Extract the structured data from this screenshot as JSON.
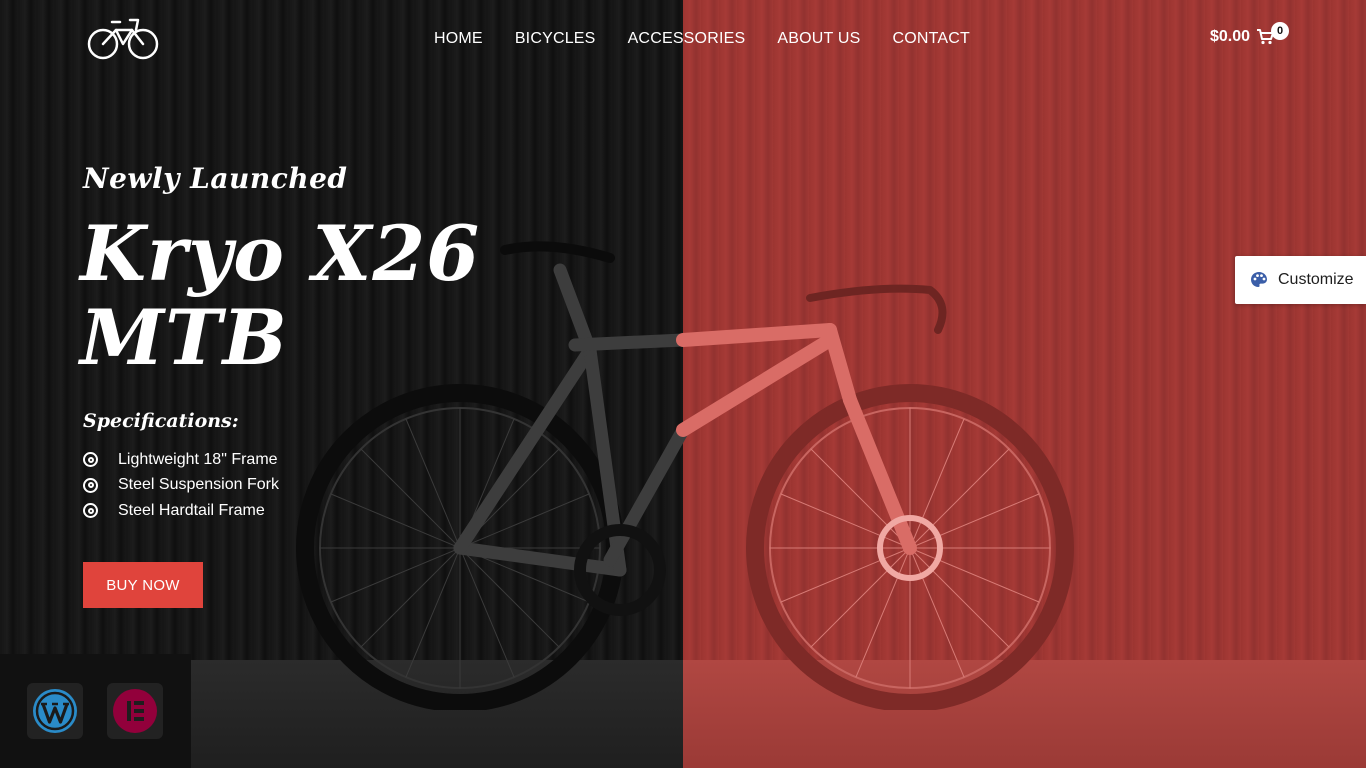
{
  "colors": {
    "accent": "#e0443c",
    "overlay_red": "#a13834",
    "dark": "#151515"
  },
  "header": {
    "logo_icon": "bicycle-icon",
    "nav": [
      {
        "label": "HOME"
      },
      {
        "label": "BICYCLES"
      },
      {
        "label": "ACCESSORIES"
      },
      {
        "label": "ABOUT US"
      },
      {
        "label": "CONTACT"
      }
    ],
    "cart": {
      "total": "$0.00",
      "count": "0",
      "icon": "cart-icon"
    }
  },
  "hero": {
    "eyebrow": "Newly Launched",
    "title_line1": "Kryo X26",
    "title_line2": "MTB",
    "specs_heading": "Specifications:",
    "specs": [
      {
        "label": "Lightweight 18\" Frame"
      },
      {
        "label": "Steel Suspension Fork"
      },
      {
        "label": "Steel Hardtail Frame"
      }
    ],
    "cta": "BUY NOW"
  },
  "customize": {
    "label": "Customize",
    "icon": "palette-icon"
  },
  "builders": [
    {
      "name": "wordpress-icon"
    },
    {
      "name": "elementor-icon"
    }
  ]
}
